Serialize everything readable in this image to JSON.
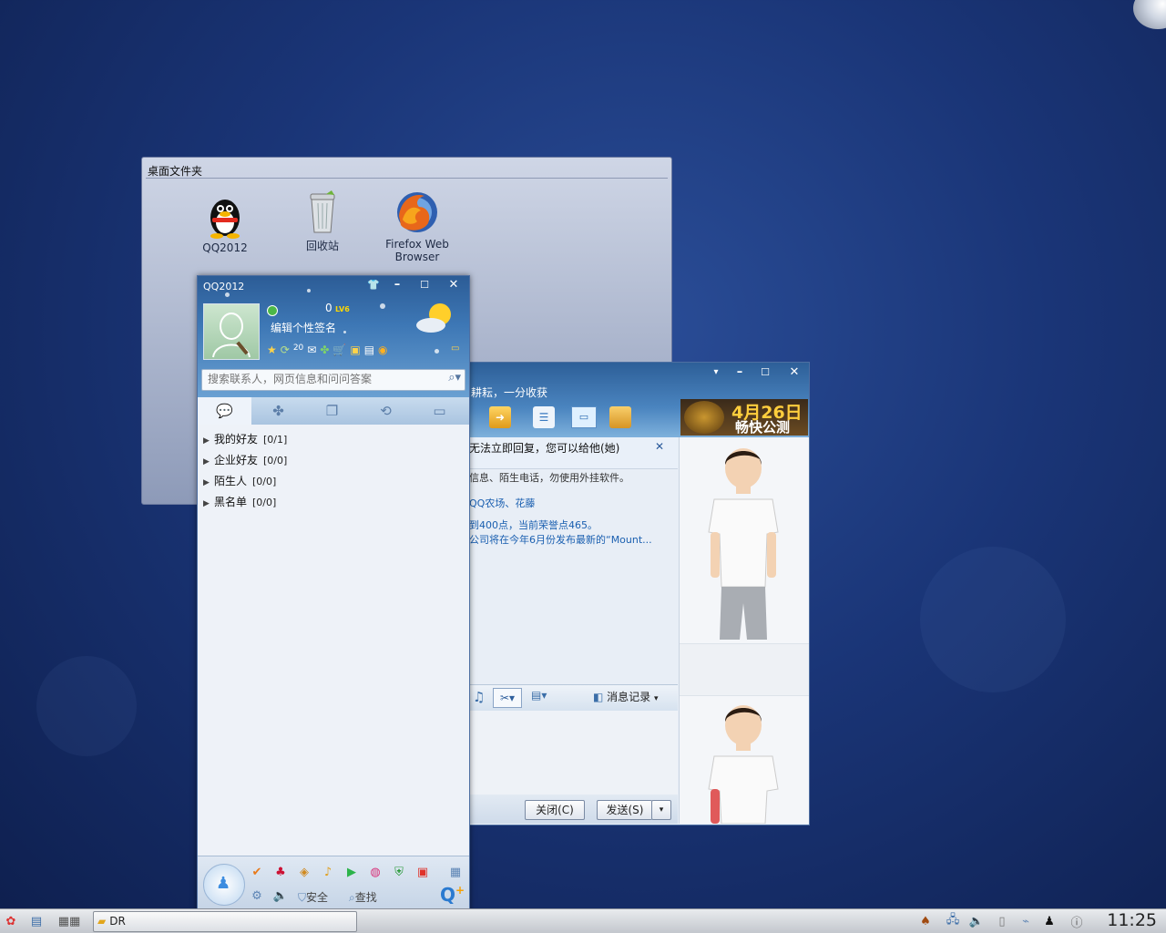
{
  "desktop": {
    "icons": [
      {
        "label": "QQ2012",
        "icon": "qq-penguin-icon"
      },
      {
        "label": "回收站",
        "icon": "trash-icon"
      },
      {
        "label": "Firefox Web Browser",
        "icon": "firefox-icon"
      }
    ]
  },
  "folder": {
    "title": "桌面文件夹"
  },
  "qq": {
    "title": "QQ2012",
    "level_num": "0",
    "level_badge": "LV6",
    "signature": "编辑个性签名",
    "mail_count": "20",
    "search_placeholder": "搜索联系人，网页信息和问问答案",
    "groups": [
      {
        "name": "我的好友",
        "count": "[0/1]"
      },
      {
        "name": "企业好友",
        "count": "[0/0]"
      },
      {
        "name": "陌生人",
        "count": "[0/0]"
      },
      {
        "name": "黑名单",
        "count": "[0/0]"
      }
    ],
    "bottom": {
      "security": "安全",
      "find": "查找"
    }
  },
  "chat": {
    "marquee": "耕耘，一分收获",
    "ad_date": "4月26日",
    "ad_sub": "畅快公测",
    "notice": "无法立即回复，您可以给他(她)",
    "messages": [
      "信息、陌生电话，勿使用外挂软件。",
      "QQ农场、花藤",
      "到400点，当前荣誉点465。",
      "公司将在今年6月份发布最新的“Mount..."
    ],
    "history": "消息记录",
    "close_btn": "关闭(C)",
    "send_btn": "发送(S)"
  },
  "taskbar": {
    "task_label": "DR",
    "clock": "11:25"
  },
  "colors": {
    "accent": "#2d5f98",
    "link": "#1a5fb0"
  }
}
